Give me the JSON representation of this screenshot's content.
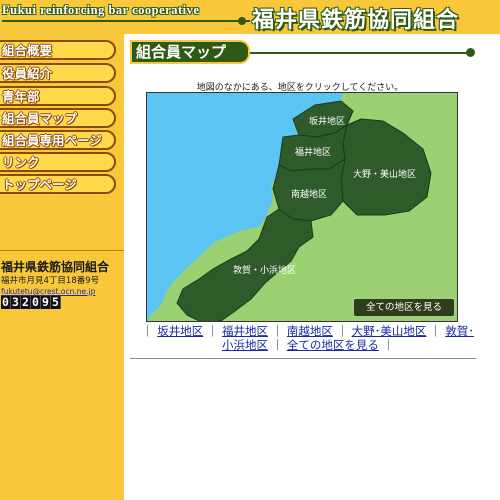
{
  "banner": {
    "english_title": "Fukui reinforcing bar cooperative",
    "japanese_title": "福井県鉄筋協同組合"
  },
  "sidebar": {
    "items": [
      {
        "label": "組合概要"
      },
      {
        "label": "役員紹介"
      },
      {
        "label": "青年部"
      },
      {
        "label": "組合員マップ"
      },
      {
        "label": "組合員専用ページ"
      },
      {
        "label": "リンク"
      },
      {
        "label": "トップページ"
      }
    ],
    "org_name": "福井県鉄筋協同組合",
    "address": "福井市月見4丁目18番9号",
    "email": "fukutetu@crest.ocn.ne.jp",
    "counter": [
      "0",
      "3",
      "2",
      "0",
      "9",
      "5"
    ]
  },
  "main": {
    "heading": "組合員マップ",
    "instruction": "地図のなかにある、地区をクリックしてください。",
    "map": {
      "regions": {
        "sakai": "坂井地区",
        "fukui": "福井地区",
        "ono": "大野・美山地区",
        "nanetsu": "南越地区",
        "tsuruga": "敦賀・小浜地区"
      },
      "all_button": "全ての地区を見る",
      "colors": {
        "sea": "#5bc4f2",
        "land": "#9bd073",
        "region": "#2f5a2a"
      }
    },
    "links": {
      "open": "｜",
      "sep": "｜",
      "close": "｜",
      "items": [
        "坂井地区",
        "福井地区",
        "南越地区",
        "大野･美山地区",
        "敦賀･小浜地区",
        "全ての地区を見る"
      ]
    }
  },
  "colors": {
    "accent_yellow": "#f9c83a",
    "dark_green": "#2f5a14",
    "link_blue": "#1a2aa8"
  }
}
